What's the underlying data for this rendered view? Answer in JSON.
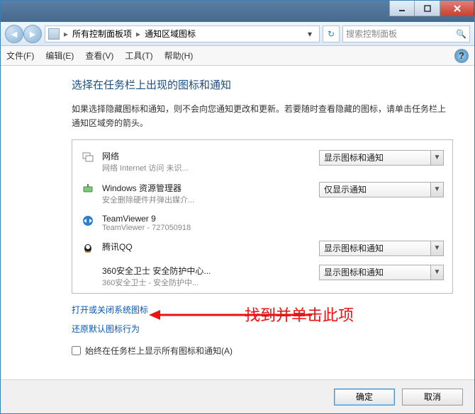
{
  "titlebar": {},
  "breadcrumb": {
    "part1": "所有控制面板项",
    "part2": "通知区域图标"
  },
  "search": {
    "placeholder": "搜索控制面板"
  },
  "menu": {
    "file": "文件(F)",
    "edit": "编辑(E)",
    "view": "查看(V)",
    "tools": "工具(T)",
    "help": "帮助(H)"
  },
  "heading": "选择在任务栏上出现的图标和通知",
  "description": "如果选择隐藏图标和通知，则不会向您通知更改和更新。若要随时查看隐藏的图标，请单击任务栏上通知区域旁的箭头。",
  "items": [
    {
      "title": "网络",
      "sub": "网络 Internet 访问 未识...",
      "combo": "显示图标和通知",
      "icon": "network"
    },
    {
      "title": "Windows 资源管理器",
      "sub": "安全删除硬件并弹出媒介...",
      "combo": "仅显示通知",
      "icon": "explorer"
    },
    {
      "title": "TeamViewer 9",
      "sub": "TeamViewer - 727050918",
      "combo": "",
      "icon": "teamviewer"
    },
    {
      "title": "腾讯QQ",
      "sub": "",
      "combo": "显示图标和通知",
      "icon": "qq"
    },
    {
      "title": "360安全卫士 安全防护中心...",
      "sub": "360安全卫士 - 安全防护中...",
      "combo": "显示图标和通知",
      "icon": "360"
    }
  ],
  "links": {
    "l1": "打开或关闭系统图标",
    "l2": "还原默认图标行为"
  },
  "checkbox": "始终在任务栏上显示所有图标和通知(A)",
  "buttons": {
    "ok": "确定",
    "cancel": "取消"
  },
  "annotation": "找到并单击此项"
}
